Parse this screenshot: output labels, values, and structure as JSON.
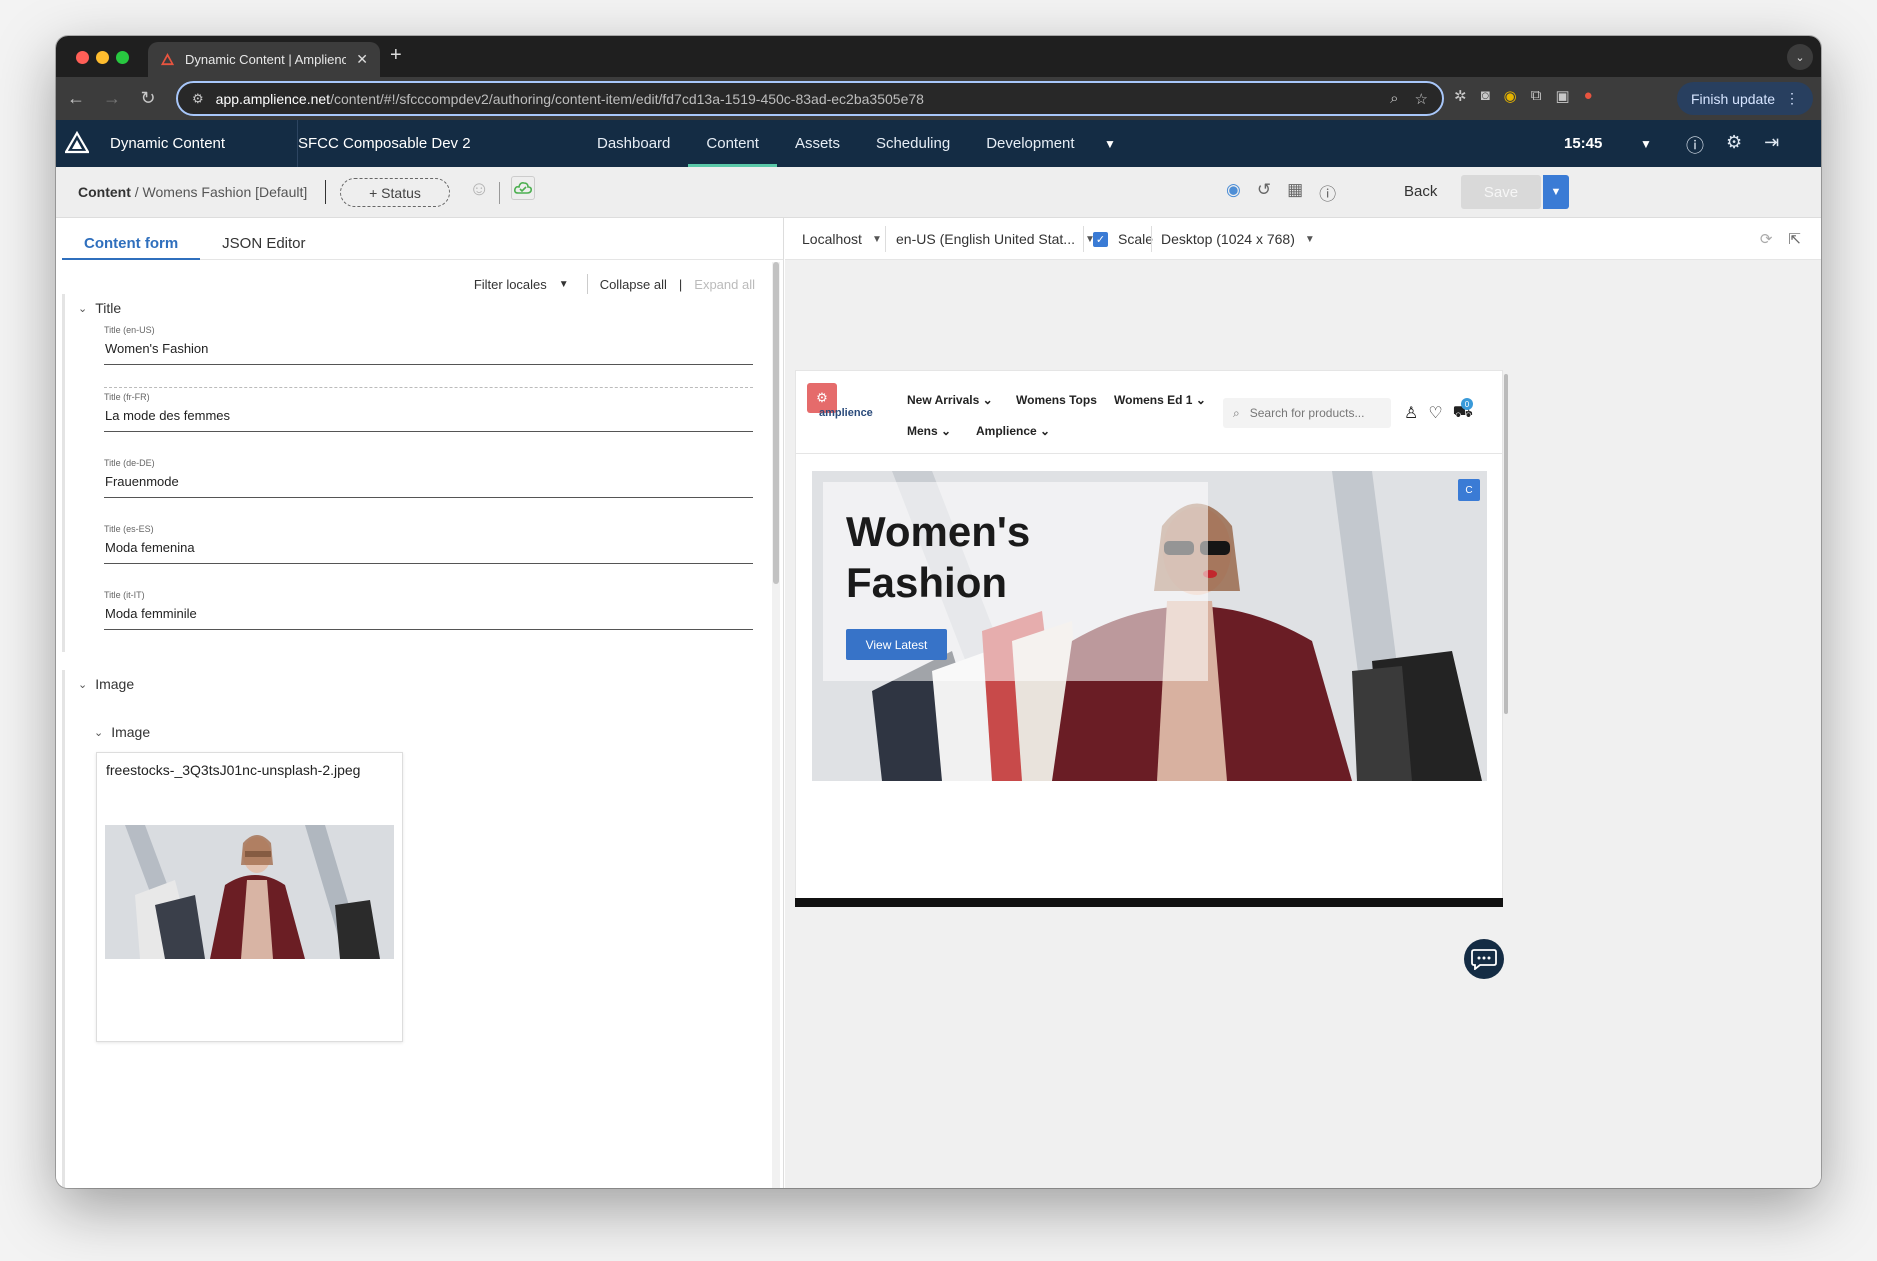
{
  "browser": {
    "tab_title": "Dynamic Content | Amplience",
    "url_host": "app.amplience.net",
    "url_path": "/content/#!/sfcccompdev2/authoring/content-item/edit/fd7cd13a-1519-450c-83ad-ec2ba3505e78",
    "finish_update": "Finish update"
  },
  "app": {
    "name": "Dynamic Content",
    "hub": "SFCC Composable Dev 2",
    "nav": [
      "Dashboard",
      "Content",
      "Assets",
      "Scheduling",
      "Development"
    ],
    "active_nav": "Content",
    "time": "15:45"
  },
  "content_bar": {
    "root": "Content",
    "path": "/ Womens Fashion [Default]",
    "status": "+ Status",
    "back": "Back",
    "save": "Save"
  },
  "editor": {
    "tabs": [
      "Content form",
      "JSON Editor"
    ],
    "filter_locales": "Filter locales",
    "collapse_all": "Collapse all",
    "expand_all": "Expand all",
    "title_section": "Title",
    "fields": [
      {
        "label": "Title (en-US)",
        "value": "Women's Fashion"
      },
      {
        "label": "Title (fr-FR)",
        "value": "La mode des femmes"
      },
      {
        "label": "Title (de-DE)",
        "value": "Frauenmode"
      },
      {
        "label": "Title (es-ES)",
        "value": "Moda femenina"
      },
      {
        "label": "Title (it-IT)",
        "value": "Moda femminile"
      }
    ],
    "image_section": "Image",
    "image_subsection": "Image",
    "image_filename": "freestocks-_3Q3tsJ01nc-unsplash-2.jpeg"
  },
  "preview": {
    "environment": "Localhost",
    "locale": "en-US (English United Stat...",
    "scale_label": "Scale",
    "device": "Desktop (1024 x 768)",
    "site": {
      "brand": "amplience",
      "nav": [
        "New Arrivals",
        "Womens Tops",
        "Womens Ed 1",
        "Mens",
        "Amplience"
      ],
      "search_placeholder": "Search for products...",
      "cart_count": "0",
      "hero_title": "Women's Fashion",
      "hero_button": "View Latest",
      "hero_badge": "C"
    }
  },
  "colors": {
    "header_bg": "#142c44",
    "accent_blue": "#3a7bd5",
    "active_underline": "#5ac8a8"
  }
}
